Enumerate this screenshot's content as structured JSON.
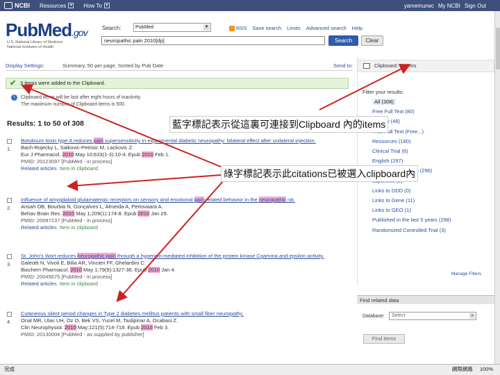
{
  "ncbi_bar": {
    "logo": "NCBI",
    "resources": "Resources",
    "howto": "How To",
    "user": "yamemurwc",
    "mynbci": "My NCBI",
    "signout": "Sign Out"
  },
  "header": {
    "logo": "PubMed",
    "logo_gov": ".gov",
    "nlm_line1": "U.S. National Library of Medicine",
    "nlm_line2": "National Institutes of Health",
    "search_label": "Search:",
    "db_selected": "PubMed",
    "rss": "RSS",
    "save_search": "Save search",
    "limits": "Limits",
    "advanced": "Advanced search",
    "help": "Help",
    "query": "neuropathic pain 2010[dp]",
    "search_btn": "Search",
    "clear_btn": "Clear"
  },
  "toolbar": {
    "display": "Display Settings:",
    "summary": "Summary, 50 per page, Sorted by Pub Date",
    "sendto": "Send to:"
  },
  "messages": {
    "added": "3 items were added to the Clipboard.",
    "info1": "Clipboard items will be lost after eight hours of inactivity.",
    "info2": "The maximum number of Clipboard items is 500."
  },
  "results_title": "Results: 1 to 50 of 308",
  "results": [
    {
      "num": "1.",
      "title_a": "Botulinum toxin type A reduces ",
      "title_hl": "pain",
      "title_b": " supersensitivity in experimental diabetic neuropathy: bilateral effect after unilateral injection.",
      "authors": "Bach-Rojecky L, Salkovic-Petrisic M, Lackovic Z.",
      "journal": "Eur J Pharmacol. ",
      "year1": "2010",
      "journal_b": " May 10;633(1-3):10-4. Epub ",
      "year2": "2010",
      "journal_c": " Feb 1.",
      "pmid": "PMID: 20123097 [PubMed - in process]",
      "related": "Related articles",
      "clip": "Item in clipboard"
    },
    {
      "num": "2.",
      "title_a": "Influence of amygdaloid glutamatergic receptors on sensory and emotional ",
      "title_hl": "pain",
      "title_b": "-related behavior in the ",
      "title_hl2": "neuropathic",
      "title_c": " rat.",
      "authors": "Ansah OB, Bourbia N, Gonçalves L, Almeida A, Pertovaara A.",
      "journal": "Behav Brain Res. ",
      "year1": "2010",
      "journal_b": " May 1;209(1):174-8. Epub ",
      "year2": "2010",
      "journal_c": " Jan 29.",
      "pmid": "PMID: 20097237 [PubMed - in process]",
      "related": "Related articles",
      "clip": "Item in clipboard"
    },
    {
      "num": "3.",
      "title_a": "St. John's Wort reduces ",
      "title_hl": "neuropathic pain",
      "title_b": " through a hypericin-mediated inhibition of the protein kinase Cgamma and epsilon activity.",
      "authors": "Galeotti N, Vivoli E, Bilia AR, Vincieri FF, Ghelardini C.",
      "journal": "Biochem Pharmacol. ",
      "year1": "2010",
      "journal_b": " May 1;79(9):1327-36. Epub ",
      "year2": "2010",
      "journal_c": " Jan 4.",
      "pmid": "PMID: 20045675 [PubMed - in process]",
      "related": "Related articles",
      "clip": "Item in clipboard"
    },
    {
      "num": "4.",
      "title_a": "Cutaneous silent period changes in Type 2 diabetes mellitus patients with small fiber neuropathy.",
      "authors": "Onal MR, Ulas UH, Oz O, Bek VS, Yucel M, Taslipinar A, Ocabasi Z.",
      "journal": "Clin Neurophysiol. ",
      "year1": "2010",
      "journal_b": " May;121(5):714-718. Epub ",
      "year2": "2010",
      "journal_c": " Feb 3.",
      "pmid": "PMID: 20130004 [PubMed - as supplied by publisher]"
    }
  ],
  "right": {
    "clipboard": "Clipboard: 3 items",
    "filter_title": "Filter your results:",
    "filters": [
      "All (308)",
      "Free Full Text (80)",
      "Review (48)",
      "Free Full Text (Free...)",
      "Resources (180)",
      "Clinical Trial (6)",
      "English (297)",
      "Items with Abstracts (296)",
      "Japanese (5)",
      "Links to DDD (0)",
      "Links to Gene (11)",
      "Links to GEO (1)",
      "Published in the last 5 years (298)",
      "Randomized Controlled Trial (3)"
    ],
    "manage": "Manage Filters",
    "related_head": "Find related data",
    "db_label": "Database:",
    "db_select": "Select",
    "find_btn": "Find items"
  },
  "status": {
    "left": "完成",
    "zone": "網際網路",
    "zoom": "100%"
  },
  "annotations": {
    "blue": "藍字標記表示從這裏可連接到Clipboard 內的items",
    "green": "綠字標記表示此citations已被選入clipboard內"
  },
  "colors": {
    "highlight": "#f3a7d4",
    "arrow": "#cc2222",
    "link": "#2a4d9c",
    "ncbi_bar": "#3d4f7a"
  }
}
